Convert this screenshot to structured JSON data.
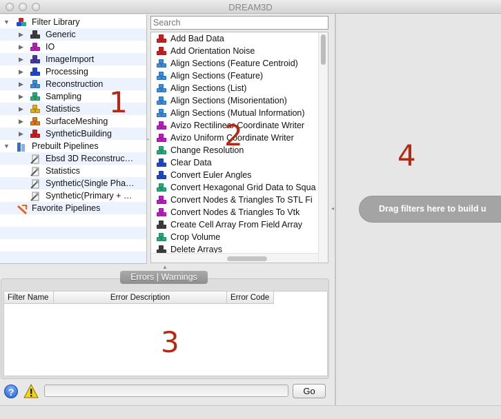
{
  "window": {
    "title": "DREAM3D"
  },
  "tree": {
    "items": [
      {
        "label": "Filter Library",
        "tri": "▼",
        "icon": "multicube-icon",
        "level": 0
      },
      {
        "label": "Generic",
        "tri": "▶",
        "icon": "cube-dark-gray-icon",
        "color": "#3e3e3e",
        "level": 1
      },
      {
        "label": "IO",
        "tri": "▶",
        "icon": "cube-magenta-icon",
        "color": "#c11cc4",
        "level": 1
      },
      {
        "label": "ImageImport",
        "tri": "▶",
        "icon": "cube-indigo-icon",
        "color": "#4937a6",
        "level": 1
      },
      {
        "label": "Processing",
        "tri": "▶",
        "icon": "cube-blue-icon",
        "color": "#1f49d3",
        "level": 1
      },
      {
        "label": "Reconstruction",
        "tri": "▶",
        "icon": "cube-lightblue-icon",
        "color": "#3a8fe0",
        "level": 1
      },
      {
        "label": "Sampling",
        "tri": "▶",
        "icon": "cube-teal-icon",
        "color": "#25ad7e",
        "level": 1
      },
      {
        "label": "Statistics",
        "tri": "▶",
        "icon": "cube-yellow-icon",
        "color": "#e0b21a",
        "level": 1
      },
      {
        "label": "SurfaceMeshing",
        "tri": "▶",
        "icon": "cube-orange-icon",
        "color": "#e0781c",
        "level": 1
      },
      {
        "label": "SyntheticBuilding",
        "tri": "▶",
        "icon": "cube-red-icon",
        "color": "#d41e1e",
        "level": 1
      },
      {
        "label": "Prebuilt Pipelines",
        "tri": "▼",
        "icon": "pipeline-folder-icon",
        "level": 0
      },
      {
        "label": "Ebsd 3D Reconstruc…",
        "tri": "",
        "icon": "pipeline-doc-icon",
        "level": 2
      },
      {
        "label": "Statistics",
        "tri": "",
        "icon": "pipeline-doc-icon",
        "level": 2
      },
      {
        "label": "Synthetic(Single Pha…",
        "tri": "",
        "icon": "pipeline-doc-icon",
        "level": 2
      },
      {
        "label": "Synthetic(Primary + …",
        "tri": "",
        "icon": "pipeline-doc-icon",
        "level": 2
      },
      {
        "label": "Favorite Pipelines",
        "tri": "",
        "icon": "favorite-icon",
        "level": 0
      }
    ]
  },
  "search": {
    "placeholder": "Search"
  },
  "filters": [
    {
      "label": "Add Bad Data",
      "color": "#d41e1e"
    },
    {
      "label": "Add Orientation Noise",
      "color": "#d41e1e"
    },
    {
      "label": "Align Sections (Feature Centroid)",
      "color": "#3a8fe0"
    },
    {
      "label": "Align Sections (Feature)",
      "color": "#3a8fe0"
    },
    {
      "label": "Align Sections (List)",
      "color": "#3a8fe0"
    },
    {
      "label": "Align Sections (Misorientation)",
      "color": "#3a8fe0"
    },
    {
      "label": "Align Sections (Mutual Information)",
      "color": "#3a8fe0"
    },
    {
      "label": "Avizo Rectilinear Coordinate Writer",
      "color": "#c11cc4"
    },
    {
      "label": "Avizo Uniform Coordinate Writer",
      "color": "#c11cc4"
    },
    {
      "label": "Change Resolution",
      "color": "#25ad7e"
    },
    {
      "label": "Clear Data",
      "color": "#1f49d3"
    },
    {
      "label": "Convert Euler Angles",
      "color": "#1f49d3"
    },
    {
      "label": "Convert Hexagonal Grid Data to Squa",
      "color": "#25ad7e"
    },
    {
      "label": "Convert Nodes & Triangles To STL Fi",
      "color": "#c11cc4"
    },
    {
      "label": "Convert Nodes & Triangles To Vtk",
      "color": "#c11cc4"
    },
    {
      "label": "Create Cell Array From Field Array",
      "color": "#3e3e3e"
    },
    {
      "label": "Crop Volume",
      "color": "#25ad7e"
    },
    {
      "label": "Delete Arrays",
      "color": "#3e3e3e"
    }
  ],
  "errors": {
    "tab_label": "Errors | Warnings",
    "columns": [
      "Filter Name",
      "Error Description",
      "Error Code"
    ]
  },
  "status": {
    "help_glyph": "?",
    "go_label": "Go"
  },
  "pipeline": {
    "drop_hint": "Drag filters here to build u"
  },
  "annotations": [
    "1",
    "2",
    "3",
    "4"
  ]
}
